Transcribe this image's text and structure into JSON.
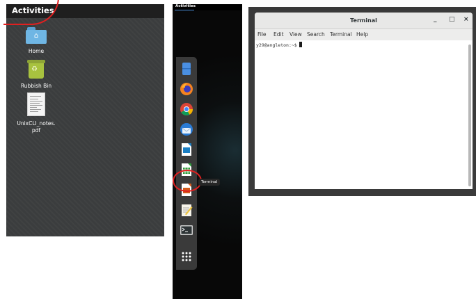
{
  "left_panel": {
    "activities_label": "Activities",
    "desktop_items": [
      {
        "label": "Home",
        "icon": "home-folder-icon"
      },
      {
        "label": "Rubbish Bin",
        "icon": "trash-icon"
      },
      {
        "label_line1": "UnixCLI_notes.",
        "label_line2": "pdf",
        "icon": "pdf-document-icon"
      }
    ]
  },
  "middle_panel": {
    "activities_label": "Activities",
    "dock": [
      {
        "name": "files-icon",
        "color": "#4a8fe2"
      },
      {
        "name": "firefox-icon",
        "color": "#e66000"
      },
      {
        "name": "chrome-icon",
        "color": "#db4437"
      },
      {
        "name": "thunderbird-icon",
        "color": "#2a7bd5"
      },
      {
        "name": "writer-icon",
        "color": "#1b7fc4"
      },
      {
        "name": "calc-icon",
        "color": "#2e9e3c"
      },
      {
        "name": "impress-icon",
        "color": "#d35b1d"
      },
      {
        "name": "text-editor-icon",
        "color": "#f0c43a"
      },
      {
        "name": "terminal-icon",
        "color": "#2e3436"
      },
      {
        "name": "show-apps-icon",
        "color": "#ffffff"
      }
    ],
    "tooltip": "Terminal"
  },
  "terminal_window": {
    "title": "Terminal",
    "minimize": "_",
    "maximize": "□",
    "close": "×",
    "menu": [
      "File",
      "Edit",
      "View",
      "Search",
      "Terminal",
      "Help"
    ],
    "prompt": "y29@angleton:~$"
  }
}
